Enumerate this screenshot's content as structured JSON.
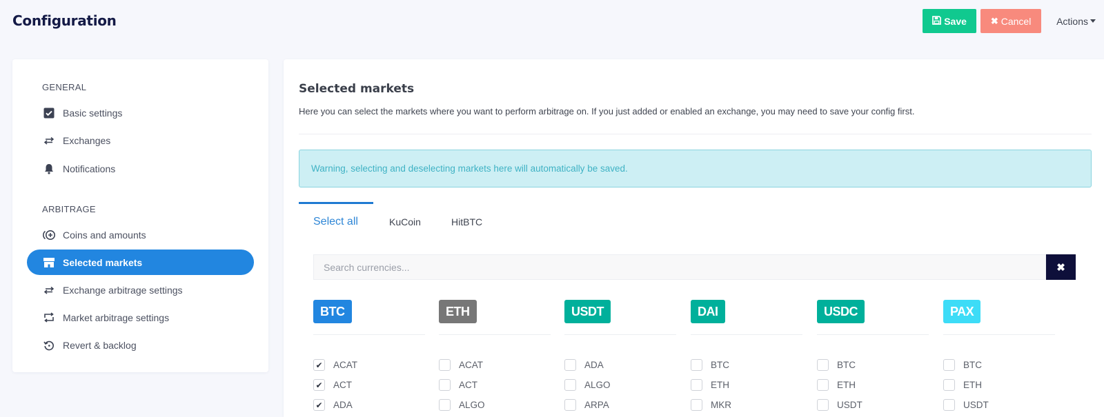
{
  "header": {
    "title": "Configuration",
    "save_label": "Save",
    "save_icon": "floppy-disk-icon",
    "cancel_label": "Cancel",
    "cancel_icon": "times-icon",
    "actions_label": "Actions"
  },
  "sidebar": {
    "sections": [
      {
        "label": "GENERAL",
        "items": [
          {
            "label": "Basic settings",
            "icon": "check-square-icon"
          },
          {
            "label": "Exchanges",
            "icon": "exchange-arrows-icon"
          },
          {
            "label": "Notifications",
            "icon": "bell-icon"
          }
        ]
      },
      {
        "label": "ARBITRAGE",
        "items": [
          {
            "label": "Coins and amounts",
            "icon": "coins-plus-icon"
          },
          {
            "label": "Selected markets",
            "icon": "store-icon",
            "active": true
          },
          {
            "label": "Exchange arbitrage settings",
            "icon": "exchange-arrows-icon"
          },
          {
            "label": "Market arbitrage settings",
            "icon": "retweet-icon"
          },
          {
            "label": "Revert & backlog",
            "icon": "history-icon"
          }
        ]
      }
    ]
  },
  "main": {
    "title": "Selected markets",
    "description": "Here you can select the markets where you want to perform arbitrage on. If you just added or enabled an exchange, you may need to save your config first.",
    "alert": "Warning, selecting and deselecting markets here will automatically be saved.",
    "tabs": [
      {
        "label": "Select all",
        "active": true
      },
      {
        "label": "KuCoin"
      },
      {
        "label": "HitBTC"
      }
    ],
    "search": {
      "placeholder": "Search currencies...",
      "value": "",
      "clear_icon": "times-icon"
    },
    "columns": [
      {
        "base": "BTC",
        "color": "#2286e0",
        "markets": [
          {
            "name": "ACAT",
            "checked": true
          },
          {
            "name": "ACT",
            "checked": true
          },
          {
            "name": "ADA",
            "checked": true
          }
        ]
      },
      {
        "base": "ETH",
        "color": "#777777",
        "markets": [
          {
            "name": "ACAT",
            "checked": false
          },
          {
            "name": "ACT",
            "checked": false
          },
          {
            "name": "ALGO",
            "checked": false
          }
        ]
      },
      {
        "base": "USDT",
        "color": "#00b09b",
        "markets": [
          {
            "name": "ADA",
            "checked": false
          },
          {
            "name": "ALGO",
            "checked": false
          },
          {
            "name": "ARPA",
            "checked": false
          }
        ]
      },
      {
        "base": "DAI",
        "color": "#00b09b",
        "markets": [
          {
            "name": "BTC",
            "checked": false
          },
          {
            "name": "ETH",
            "checked": false
          },
          {
            "name": "MKR",
            "checked": false
          }
        ]
      },
      {
        "base": "USDC",
        "color": "#00b09b",
        "markets": [
          {
            "name": "BTC",
            "checked": false
          },
          {
            "name": "ETH",
            "checked": false
          },
          {
            "name": "USDT",
            "checked": false
          }
        ]
      },
      {
        "base": "PAX",
        "color": "#3ddcf7",
        "markets": [
          {
            "name": "BTC",
            "checked": false
          },
          {
            "name": "ETH",
            "checked": false
          },
          {
            "name": "USDT",
            "checked": false
          }
        ]
      }
    ]
  }
}
